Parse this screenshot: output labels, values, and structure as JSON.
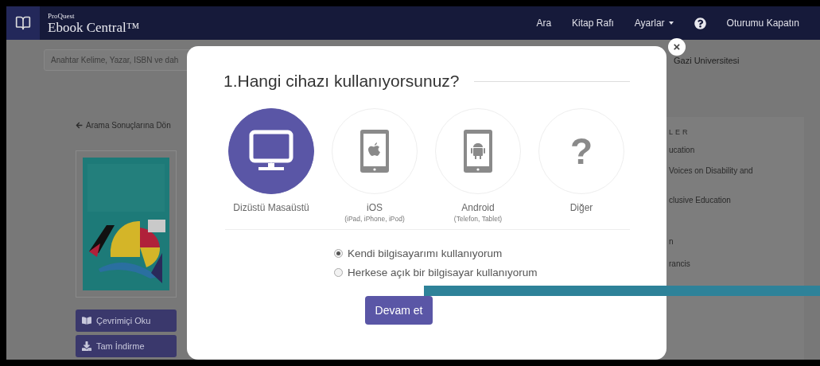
{
  "navbar": {
    "brand_small": "ProQuest",
    "brand_name": "Ebook Central™",
    "links": [
      {
        "kind": "link",
        "label": "Ara"
      },
      {
        "kind": "link",
        "label": "Kitap Rafı"
      },
      {
        "kind": "dropdown",
        "label": "Ayarlar"
      },
      {
        "kind": "help"
      },
      {
        "kind": "link",
        "label": "Oturumu Kapatın"
      }
    ]
  },
  "page": {
    "search": {
      "placeholder": "Anahtar Kelime, Yazar, ISBN ve dah"
    },
    "institution": "Gazi Universitesi",
    "back_link": "Arama Sonuçlarına Dön",
    "actions": [
      {
        "kind": "read",
        "label": "Çevrimiçi Oku"
      },
      {
        "kind": "download",
        "label": "Tam İndirme"
      }
    ],
    "details": {
      "heading": "LER",
      "lines": [
        "ucation",
        "Voices on Disability and",
        "clusive Education",
        "n",
        "rancis"
      ]
    }
  },
  "modal": {
    "close": "×",
    "title": "1.Hangi cihazı kullanıyorsunuz?",
    "devices": [
      {
        "kind": "desktop",
        "label": "Dizüstü Masaüstü",
        "selected": true
      },
      {
        "kind": "ios",
        "label": "iOS",
        "sublabel": "(iPad, iPhone, iPod)",
        "selected": false
      },
      {
        "kind": "android",
        "label": "Android",
        "sublabel": "(Telefon, Tablet)",
        "selected": false
      },
      {
        "kind": "other",
        "symbol": "?",
        "label": "Diğer",
        "selected": false
      }
    ],
    "options": [
      {
        "label": "Kendi bilgisayarımı kullanıyorum",
        "selected": true
      },
      {
        "label": "Herkese açık bir bilgisayar kullanıyorum",
        "selected": false
      }
    ],
    "button": "Devam et"
  }
}
